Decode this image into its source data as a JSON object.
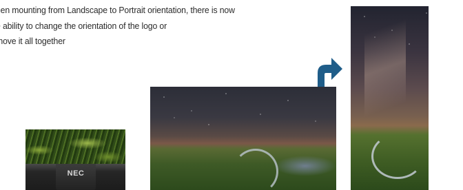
{
  "caption": {
    "line1": "hen mounting from Landscape to Portrait orientation, there is now",
    "line2": "e ability to change the orientation of the logo or",
    "line3": "move it all together"
  },
  "closeup": {
    "logo_text": "NEC"
  },
  "icons": {
    "rotate_arrow": "curved-arrow-right-icon"
  },
  "colors": {
    "text": "#2b2b2b",
    "arrow": "#1f5d89",
    "bezel": "#222222"
  }
}
